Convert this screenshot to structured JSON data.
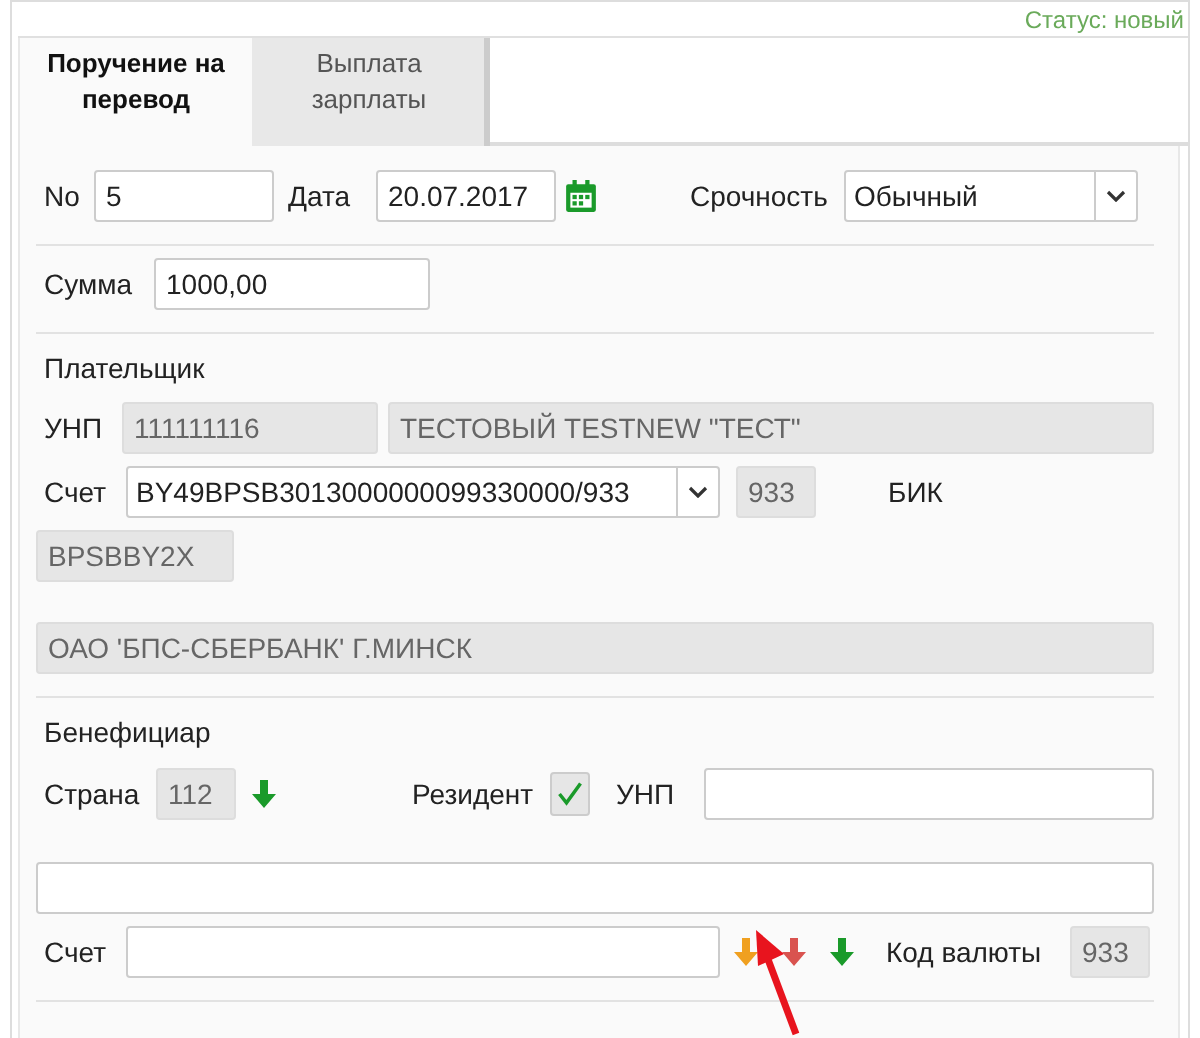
{
  "status": "Статус: новый",
  "tabs": [
    {
      "label": "Поручение на перевод",
      "selected": true
    },
    {
      "label": "Выплата зарплаты",
      "selected": false
    }
  ],
  "document": {
    "number_label": "No",
    "number": "5",
    "date_label": "Дата",
    "date": "20.07.2017",
    "urgency_label": "Срочность",
    "urgency": "Обычный"
  },
  "amount": {
    "label": "Сумма",
    "value": "1000,00"
  },
  "payer": {
    "title": "Плательщик",
    "unp_label": "УНП",
    "unp": "111111116",
    "name": "ТЕСТОВЫЙ TESTNEW \"ТЕСТ\"",
    "account_label": "Счет",
    "account": "BY49BPSB3013000000099330000/933",
    "currency": "933",
    "bic_label": "БИК",
    "bic": "BPSBBY2X",
    "bank": "ОАО 'БПС-СБЕРБАНК' Г.МИНСК"
  },
  "beneficiary": {
    "title": "Бенефициар",
    "country_label": "Страна",
    "country": "112",
    "country_arrow": {
      "color": "#1a9a2a"
    },
    "resident_label": "Резидент",
    "resident": true,
    "unp_label": "УНП",
    "account_label": "Счет",
    "account_arrows": [
      {
        "color": "#f0a020"
      },
      {
        "color": "#d9534f"
      },
      {
        "color": "#1a9a2a"
      }
    ],
    "currency_label": "Код валюты",
    "currency": "933"
  }
}
